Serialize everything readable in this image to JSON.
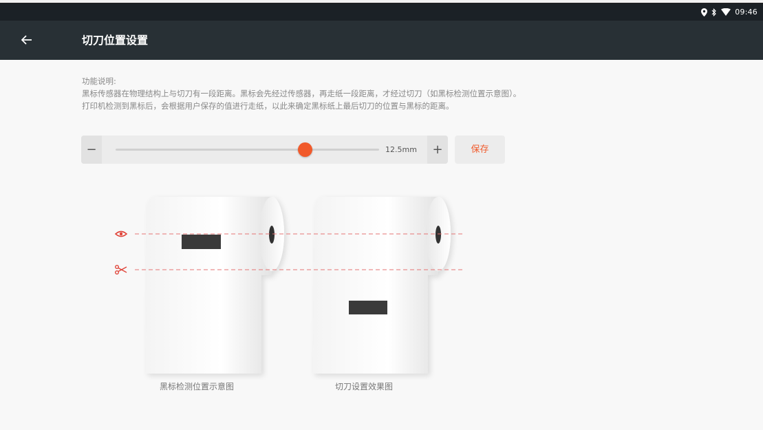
{
  "status_bar": {
    "time": "09:46",
    "icons": [
      "location-icon",
      "bluetooth-icon",
      "wifi-icon"
    ]
  },
  "app_bar": {
    "title": "切刀位置设置",
    "back_icon": "arrow-left-icon"
  },
  "description": {
    "heading": "功能说明:",
    "line1": "黑标传感器在物理结构上与切刀有一段距离。黑标会先经过传感器，再走纸一段距离，才经过切刀（如黑标检测位置示意图）。",
    "line2": "打印机检测到黑标后，会根据用户保存的值进行走纸，以此来确定黑标纸上最后切刀的位置与黑标的距离。"
  },
  "slider": {
    "value_label": "12.5mm",
    "position_fraction": 0.72,
    "minus_label": "−",
    "plus_label": "+"
  },
  "save_button": {
    "label": "保存"
  },
  "diagram": {
    "caption_left": "黑标检测位置示意图",
    "caption_right": "切刀设置效果图",
    "sensor_icon": "eye-icon",
    "cutter_icon": "scissors-icon",
    "accent_color": "#f15a2b",
    "line_color": "#e57373"
  },
  "colors": {
    "status_bar": "#1b2126",
    "app_bar": "#283035",
    "accent": "#f15a2b"
  }
}
